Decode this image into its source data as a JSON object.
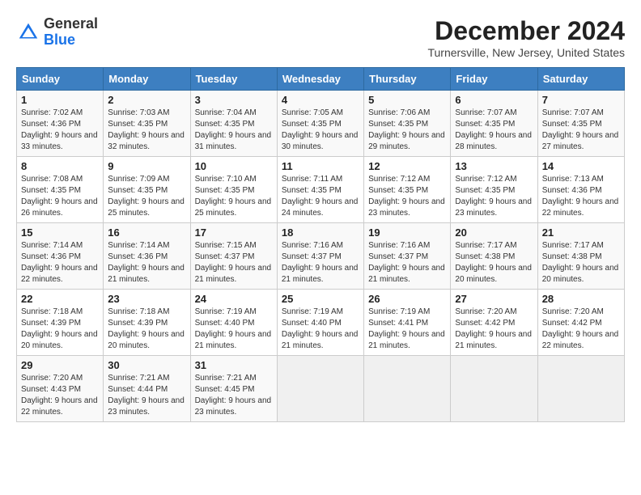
{
  "header": {
    "logo_general": "General",
    "logo_blue": "Blue",
    "month_title": "December 2024",
    "location": "Turnersville, New Jersey, United States"
  },
  "days_of_week": [
    "Sunday",
    "Monday",
    "Tuesday",
    "Wednesday",
    "Thursday",
    "Friday",
    "Saturday"
  ],
  "weeks": [
    [
      {
        "day": "1",
        "sunrise": "7:02 AM",
        "sunset": "4:36 PM",
        "daylight": "9 hours and 33 minutes."
      },
      {
        "day": "2",
        "sunrise": "7:03 AM",
        "sunset": "4:35 PM",
        "daylight": "9 hours and 32 minutes."
      },
      {
        "day": "3",
        "sunrise": "7:04 AM",
        "sunset": "4:35 PM",
        "daylight": "9 hours and 31 minutes."
      },
      {
        "day": "4",
        "sunrise": "7:05 AM",
        "sunset": "4:35 PM",
        "daylight": "9 hours and 30 minutes."
      },
      {
        "day": "5",
        "sunrise": "7:06 AM",
        "sunset": "4:35 PM",
        "daylight": "9 hours and 29 minutes."
      },
      {
        "day": "6",
        "sunrise": "7:07 AM",
        "sunset": "4:35 PM",
        "daylight": "9 hours and 28 minutes."
      },
      {
        "day": "7",
        "sunrise": "7:07 AM",
        "sunset": "4:35 PM",
        "daylight": "9 hours and 27 minutes."
      }
    ],
    [
      {
        "day": "8",
        "sunrise": "7:08 AM",
        "sunset": "4:35 PM",
        "daylight": "9 hours and 26 minutes."
      },
      {
        "day": "9",
        "sunrise": "7:09 AM",
        "sunset": "4:35 PM",
        "daylight": "9 hours and 25 minutes."
      },
      {
        "day": "10",
        "sunrise": "7:10 AM",
        "sunset": "4:35 PM",
        "daylight": "9 hours and 25 minutes."
      },
      {
        "day": "11",
        "sunrise": "7:11 AM",
        "sunset": "4:35 PM",
        "daylight": "9 hours and 24 minutes."
      },
      {
        "day": "12",
        "sunrise": "7:12 AM",
        "sunset": "4:35 PM",
        "daylight": "9 hours and 23 minutes."
      },
      {
        "day": "13",
        "sunrise": "7:12 AM",
        "sunset": "4:35 PM",
        "daylight": "9 hours and 23 minutes."
      },
      {
        "day": "14",
        "sunrise": "7:13 AM",
        "sunset": "4:36 PM",
        "daylight": "9 hours and 22 minutes."
      }
    ],
    [
      {
        "day": "15",
        "sunrise": "7:14 AM",
        "sunset": "4:36 PM",
        "daylight": "9 hours and 22 minutes."
      },
      {
        "day": "16",
        "sunrise": "7:14 AM",
        "sunset": "4:36 PM",
        "daylight": "9 hours and 21 minutes."
      },
      {
        "day": "17",
        "sunrise": "7:15 AM",
        "sunset": "4:37 PM",
        "daylight": "9 hours and 21 minutes."
      },
      {
        "day": "18",
        "sunrise": "7:16 AM",
        "sunset": "4:37 PM",
        "daylight": "9 hours and 21 minutes."
      },
      {
        "day": "19",
        "sunrise": "7:16 AM",
        "sunset": "4:37 PM",
        "daylight": "9 hours and 21 minutes."
      },
      {
        "day": "20",
        "sunrise": "7:17 AM",
        "sunset": "4:38 PM",
        "daylight": "9 hours and 20 minutes."
      },
      {
        "day": "21",
        "sunrise": "7:17 AM",
        "sunset": "4:38 PM",
        "daylight": "9 hours and 20 minutes."
      }
    ],
    [
      {
        "day": "22",
        "sunrise": "7:18 AM",
        "sunset": "4:39 PM",
        "daylight": "9 hours and 20 minutes."
      },
      {
        "day": "23",
        "sunrise": "7:18 AM",
        "sunset": "4:39 PM",
        "daylight": "9 hours and 20 minutes."
      },
      {
        "day": "24",
        "sunrise": "7:19 AM",
        "sunset": "4:40 PM",
        "daylight": "9 hours and 21 minutes."
      },
      {
        "day": "25",
        "sunrise": "7:19 AM",
        "sunset": "4:40 PM",
        "daylight": "9 hours and 21 minutes."
      },
      {
        "day": "26",
        "sunrise": "7:19 AM",
        "sunset": "4:41 PM",
        "daylight": "9 hours and 21 minutes."
      },
      {
        "day": "27",
        "sunrise": "7:20 AM",
        "sunset": "4:42 PM",
        "daylight": "9 hours and 21 minutes."
      },
      {
        "day": "28",
        "sunrise": "7:20 AM",
        "sunset": "4:42 PM",
        "daylight": "9 hours and 22 minutes."
      }
    ],
    [
      {
        "day": "29",
        "sunrise": "7:20 AM",
        "sunset": "4:43 PM",
        "daylight": "9 hours and 22 minutes."
      },
      {
        "day": "30",
        "sunrise": "7:21 AM",
        "sunset": "4:44 PM",
        "daylight": "9 hours and 23 minutes."
      },
      {
        "day": "31",
        "sunrise": "7:21 AM",
        "sunset": "4:45 PM",
        "daylight": "9 hours and 23 minutes."
      },
      null,
      null,
      null,
      null
    ]
  ]
}
